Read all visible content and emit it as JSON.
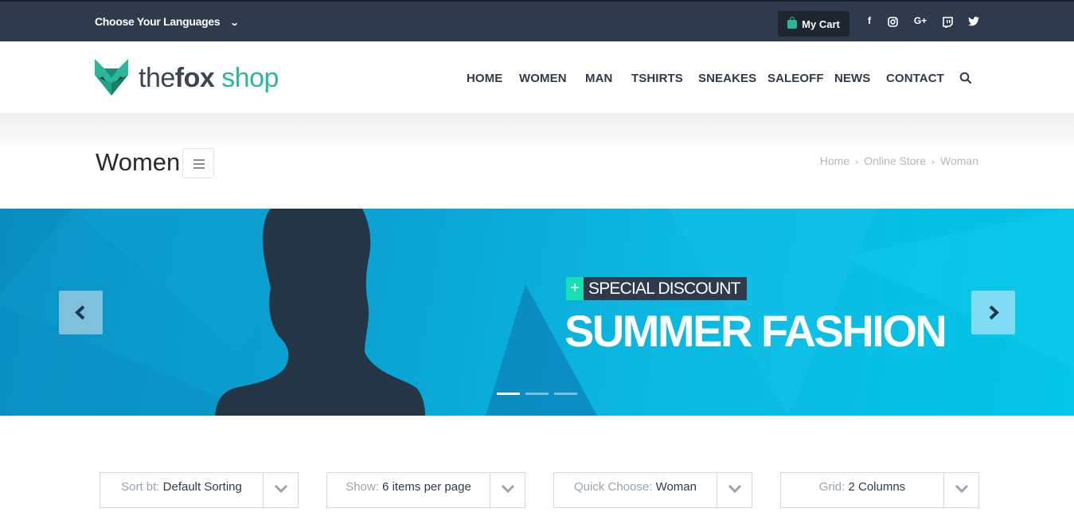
{
  "topbar": {
    "language_label": "Choose Your Languages",
    "cart_label": "My Cart",
    "social_icons": [
      "facebook-icon",
      "instagram-icon",
      "google-plus-icon",
      "twitch-icon",
      "twitter-icon"
    ],
    "social_glyphs": {
      "facebook": "f",
      "google_plus": "G+"
    }
  },
  "brand": {
    "prefix": "the",
    "bold": "fox",
    "suffix": " shop",
    "accent": "#2bb89a",
    "dark": "#2f3b4d"
  },
  "nav": {
    "items": [
      "HOME",
      "WOMEN",
      "MAN",
      "TSHIRTS",
      "SNEAKES",
      "SALEOFF",
      "NEWS",
      "CONTACT"
    ]
  },
  "page": {
    "title": "Women",
    "breadcrumb": [
      "Home",
      "Online Store",
      "Woman"
    ],
    "breadcrumb_sep": "›"
  },
  "slider": {
    "tag_plus": "+",
    "tag_text": "SPECIAL DISCOUNT",
    "headline": "SUMMER FASHION",
    "active_slide": 1,
    "slide_count": 3
  },
  "filters": [
    {
      "label": "Sort bt:",
      "value": "Default Sorting"
    },
    {
      "label": "Show:",
      "value": "6 items per page"
    },
    {
      "label": "Quick Choose:",
      "value": "Woman"
    },
    {
      "label": "Grid:",
      "value": "2 Columns"
    }
  ]
}
